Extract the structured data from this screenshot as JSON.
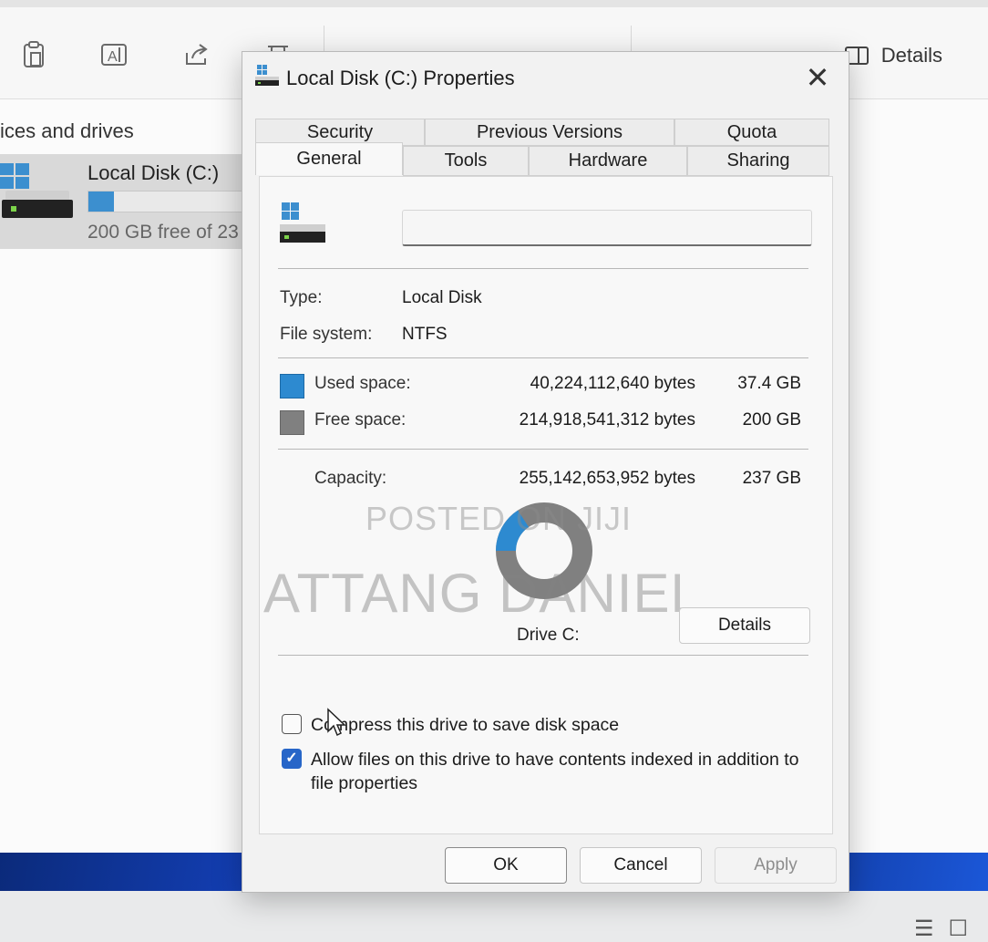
{
  "explorer": {
    "details_label": "Details",
    "section_title": "ices and drives",
    "tile": {
      "name": "Local Disk (C:)",
      "free_text": "200 GB free of 23",
      "used_fraction": 0.16
    }
  },
  "dialog": {
    "title": "Local Disk (C:) Properties",
    "tabs_back": [
      {
        "label": "Security"
      },
      {
        "label": "Previous Versions"
      },
      {
        "label": "Quota"
      }
    ],
    "tabs_front": [
      {
        "label": "General",
        "active": true
      },
      {
        "label": "Tools"
      },
      {
        "label": "Hardware"
      },
      {
        "label": "Sharing"
      }
    ],
    "name_value": "",
    "type_label": "Type:",
    "type_value": "Local Disk",
    "fs_label": "File system:",
    "fs_value": "NTFS",
    "used_label": "Used space:",
    "used_bytes": "40,224,112,640 bytes",
    "used_gb": "37.4 GB",
    "free_label": "Free space:",
    "free_bytes": "214,918,541,312 bytes",
    "free_gb": "200 GB",
    "capacity_label": "Capacity:",
    "capacity_bytes": "255,142,653,952 bytes",
    "capacity_gb": "237 GB",
    "used_fraction": 0.158,
    "drive_label": "Drive C:",
    "details_button": "Details",
    "compress_label": "Compress this drive to save disk space",
    "compress_checked": false,
    "index_label": "Allow files on this drive to have contents indexed in addition to file properties",
    "index_checked": true,
    "ok": "OK",
    "cancel": "Cancel",
    "apply": "Apply",
    "colors": {
      "used": "#2d8ad0",
      "free": "#808080",
      "checkbox": "#2766c8"
    }
  },
  "watermark": {
    "line1": "POSTED ON JIJI",
    "line2": "ATTANG DANIEL"
  }
}
